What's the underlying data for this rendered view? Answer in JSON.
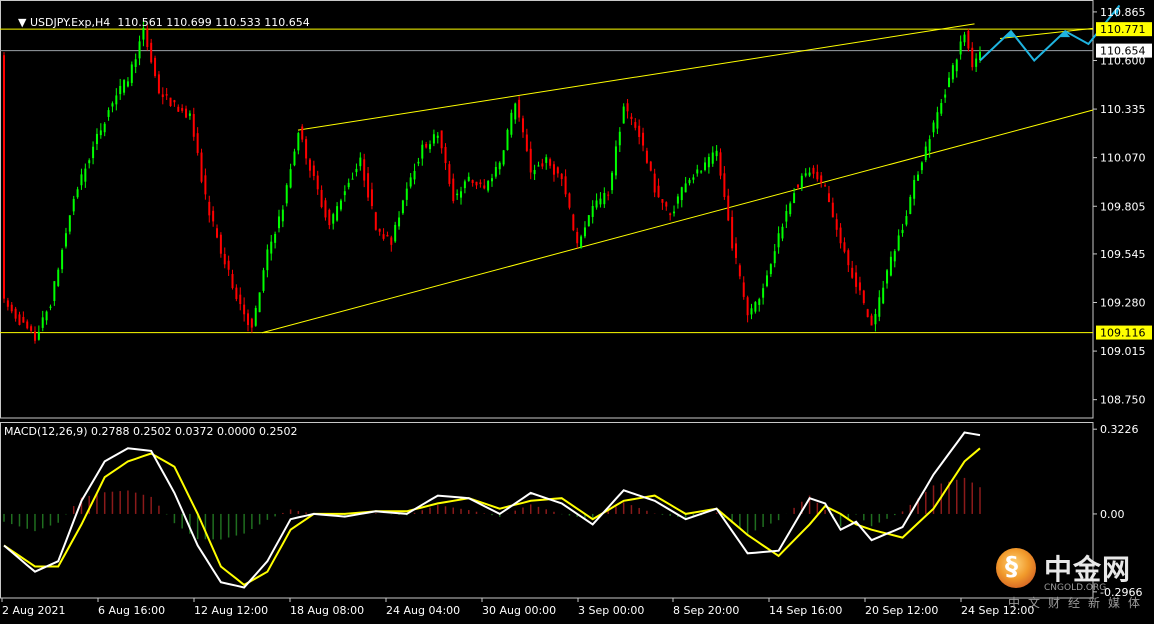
{
  "header": {
    "symbol_tf": "USDJPY.Exp,H4",
    "ohlc": "110.561 110.699 110.533 110.654"
  },
  "macd_label": "MACD(12,26,9) 0.2788 0.2502 0.0372 0.0000 0.2502",
  "watermark": {
    "logo_char": "§",
    "name": "中金网",
    "url": "CNGOLD.ORG",
    "sub": "中文财经新媒体"
  },
  "colors": {
    "bull": "#00ff00",
    "bear": "#ff0000",
    "line": "#ffff00",
    "hline": "#9aa0a6",
    "arrow": "#1fb4e0",
    "macd_main": "#ffffff",
    "macd_signal": "#ffff00",
    "hist_pos": "#8b1a1a",
    "hist_neg": "#1f6e1f"
  },
  "chart_data": [
    {
      "type": "candlestick",
      "ylim": [
        108.65,
        110.93
      ],
      "price_ticks": [
        "110.865",
        "110.600",
        "110.335",
        "110.070",
        "109.805",
        "109.545",
        "109.280",
        "109.015",
        "108.750"
      ],
      "price_tags": [
        {
          "label": "110.771",
          "value": 110.771,
          "style": "yellow"
        },
        {
          "label": "110.654",
          "value": 110.654,
          "style": "white"
        },
        {
          "label": "109.116",
          "value": 109.116,
          "style": "yellow"
        }
      ],
      "time_labels": [
        "2 Aug 2021",
        "6 Aug 16:00",
        "12 Aug 12:00",
        "18 Aug 08:00",
        "24 Aug 04:00",
        "30 Aug 00:00",
        "3 Sep 00:00",
        "8 Sep 20:00",
        "14 Sep 16:00",
        "20 Sep 12:00",
        "24 Sep 12:00"
      ],
      "horizontal_levels": [
        110.771,
        110.654,
        109.116
      ],
      "trendlines": [
        {
          "from": [
            "18 Aug 08:00",
            110.22
          ],
          "to": [
            "24 Sep 12:00",
            110.8
          ],
          "comment": "upper channel"
        },
        {
          "from": [
            "12 Aug 12:00",
            109.115
          ],
          "to": [
            "beyond 24 Sep",
            110.33
          ],
          "comment": "lower channel"
        }
      ],
      "path_points": [
        [
          0,
          109.28
        ],
        [
          4,
          109.08
        ],
        [
          6,
          109.28
        ],
        [
          9,
          109.85
        ],
        [
          12,
          110.18
        ],
        [
          14,
          110.38
        ],
        [
          16,
          110.5
        ],
        [
          18,
          110.76
        ],
        [
          20,
          110.43
        ],
        [
          22,
          110.35
        ],
        [
          24,
          110.3
        ],
        [
          26,
          109.85
        ],
        [
          28,
          109.55
        ],
        [
          30,
          109.32
        ],
        [
          32,
          109.13
        ],
        [
          34,
          109.55
        ],
        [
          36,
          109.8
        ],
        [
          38,
          110.22
        ],
        [
          40,
          109.95
        ],
        [
          42,
          109.7
        ],
        [
          44,
          109.9
        ],
        [
          46,
          110.05
        ],
        [
          48,
          109.7
        ],
        [
          50,
          109.6
        ],
        [
          52,
          109.92
        ],
        [
          54,
          110.12
        ],
        [
          56,
          110.2
        ],
        [
          58,
          109.85
        ],
        [
          60,
          109.95
        ],
        [
          62,
          109.9
        ],
        [
          64,
          110.05
        ],
        [
          66,
          110.38
        ],
        [
          68,
          110.0
        ],
        [
          70,
          110.05
        ],
        [
          72,
          109.95
        ],
        [
          74,
          109.6
        ],
        [
          76,
          109.8
        ],
        [
          78,
          109.88
        ],
        [
          80,
          110.35
        ],
        [
          82,
          110.2
        ],
        [
          84,
          109.9
        ],
        [
          86,
          109.75
        ],
        [
          88,
          109.95
        ],
        [
          90,
          110.0
        ],
        [
          92,
          110.1
        ],
        [
          94,
          109.6
        ],
        [
          96,
          109.22
        ],
        [
          98,
          109.35
        ],
        [
          100,
          109.65
        ],
        [
          102,
          109.9
        ],
        [
          104,
          110.0
        ],
        [
          106,
          109.9
        ],
        [
          108,
          109.6
        ],
        [
          110,
          109.38
        ],
        [
          112,
          109.15
        ],
        [
          114,
          109.45
        ],
        [
          116,
          109.7
        ],
        [
          118,
          110.0
        ],
        [
          120,
          110.25
        ],
        [
          122,
          110.5
        ],
        [
          124,
          110.75
        ],
        [
          125,
          110.58
        ],
        [
          126,
          110.654
        ]
      ],
      "projection": [
        [
          126,
          110.6
        ],
        [
          130,
          110.76
        ],
        [
          133,
          110.6
        ],
        [
          137,
          110.76
        ],
        [
          140,
          110.69
        ],
        [
          144,
          110.9
        ]
      ]
    },
    {
      "type": "macd",
      "params": "12,26,9",
      "values": {
        "main": 0.2788,
        "signal": 0.2502,
        "hist": 0.0372
      },
      "ylim": [
        -0.32,
        0.35
      ],
      "ticks": [
        "0.3226",
        "0.00",
        "-0.2966"
      ],
      "main": [
        [
          0,
          -0.12
        ],
        [
          4,
          -0.22
        ],
        [
          7,
          -0.18
        ],
        [
          10,
          0.05
        ],
        [
          13,
          0.2
        ],
        [
          16,
          0.25
        ],
        [
          19,
          0.24
        ],
        [
          22,
          0.08
        ],
        [
          25,
          -0.12
        ],
        [
          28,
          -0.26
        ],
        [
          31,
          -0.28
        ],
        [
          34,
          -0.18
        ],
        [
          37,
          -0.02
        ],
        [
          40,
          0.0
        ],
        [
          44,
          -0.01
        ],
        [
          48,
          0.01
        ],
        [
          52,
          0.0
        ],
        [
          56,
          0.07
        ],
        [
          60,
          0.06
        ],
        [
          64,
          0.0
        ],
        [
          68,
          0.08
        ],
        [
          72,
          0.04
        ],
        [
          76,
          -0.04
        ],
        [
          80,
          0.09
        ],
        [
          84,
          0.05
        ],
        [
          88,
          -0.02
        ],
        [
          92,
          0.02
        ],
        [
          96,
          -0.15
        ],
        [
          100,
          -0.14
        ],
        [
          104,
          0.06
        ],
        [
          106,
          0.04
        ],
        [
          108,
          -0.06
        ],
        [
          110,
          -0.03
        ],
        [
          112,
          -0.1
        ],
        [
          116,
          -0.05
        ],
        [
          120,
          0.15
        ],
        [
          124,
          0.31
        ],
        [
          126,
          0.3
        ]
      ],
      "signal": [
        [
          0,
          -0.12
        ],
        [
          4,
          -0.2
        ],
        [
          7,
          -0.2
        ],
        [
          10,
          -0.04
        ],
        [
          13,
          0.14
        ],
        [
          16,
          0.2
        ],
        [
          19,
          0.23
        ],
        [
          22,
          0.18
        ],
        [
          25,
          0.0
        ],
        [
          28,
          -0.2
        ],
        [
          31,
          -0.27
        ],
        [
          34,
          -0.22
        ],
        [
          37,
          -0.06
        ],
        [
          40,
          0.0
        ],
        [
          44,
          0.0
        ],
        [
          48,
          0.01
        ],
        [
          52,
          0.01
        ],
        [
          56,
          0.04
        ],
        [
          60,
          0.06
        ],
        [
          64,
          0.02
        ],
        [
          68,
          0.05
        ],
        [
          72,
          0.06
        ],
        [
          76,
          -0.02
        ],
        [
          80,
          0.05
        ],
        [
          84,
          0.07
        ],
        [
          88,
          0.0
        ],
        [
          92,
          0.02
        ],
        [
          96,
          -0.08
        ],
        [
          100,
          -0.16
        ],
        [
          104,
          -0.04
        ],
        [
          106,
          0.03
        ],
        [
          108,
          0.0
        ],
        [
          110,
          -0.04
        ],
        [
          112,
          -0.06
        ],
        [
          116,
          -0.09
        ],
        [
          120,
          0.02
        ],
        [
          124,
          0.2
        ],
        [
          126,
          0.25
        ]
      ]
    }
  ]
}
